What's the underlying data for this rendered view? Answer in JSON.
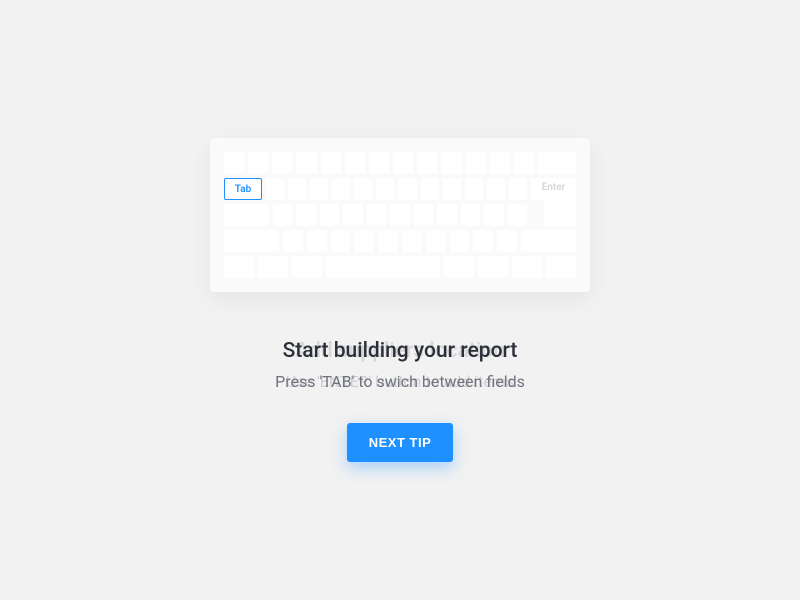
{
  "keyboard": {
    "tab_label": "Tab",
    "enter_label": "Enter"
  },
  "tip": {
    "title": "Start building your report",
    "title_ghost": "Add suppliers location",
    "subtitle": "Press 'TAB' to swich between fields",
    "subtitle_ghost": "Use 'ENTER' button to add items"
  },
  "actions": {
    "next_label": "NEXT TIP"
  },
  "colors": {
    "accent": "#1e90ff"
  }
}
